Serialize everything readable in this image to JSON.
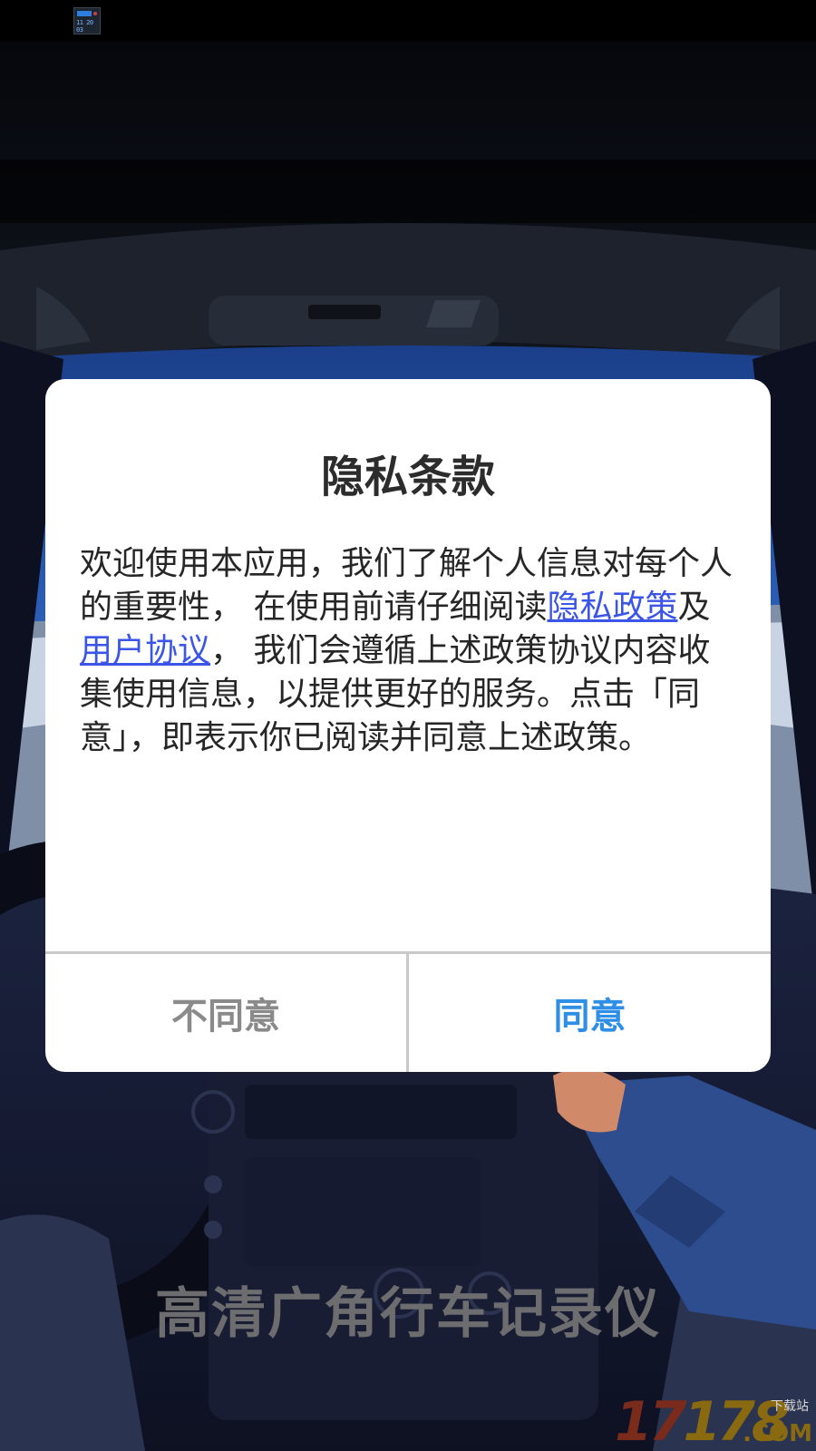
{
  "colors": {
    "link": "#3a55e8",
    "agree": "#2f8fe6",
    "disagree": "#8a8a8a",
    "dialog_bg": "#ffffff"
  },
  "background": {
    "app_title": "高清广角行车记录仪",
    "watermark": {
      "number_a": "17",
      "number_b": "178",
      "suffix": ".COM",
      "sub": "下载站"
    },
    "status_icon": "dashcam-app-icon"
  },
  "dialog": {
    "title": "隐私条款",
    "body": {
      "text_1": "欢迎使用本应用，我们了解个人信息对每个人的重要性， 在使用前请仔细阅读",
      "privacy_link": "隐私政策",
      "text_2": "及",
      "user_agreement_link": "用户协议",
      "text_3": "， 我们会遵循上述政策协议内容收集使用信息，以提供更好的服务。点击「同意」，即表示你已阅读并同意上述政策。"
    },
    "buttons": {
      "disagree": "不同意",
      "agree": "同意"
    }
  }
}
